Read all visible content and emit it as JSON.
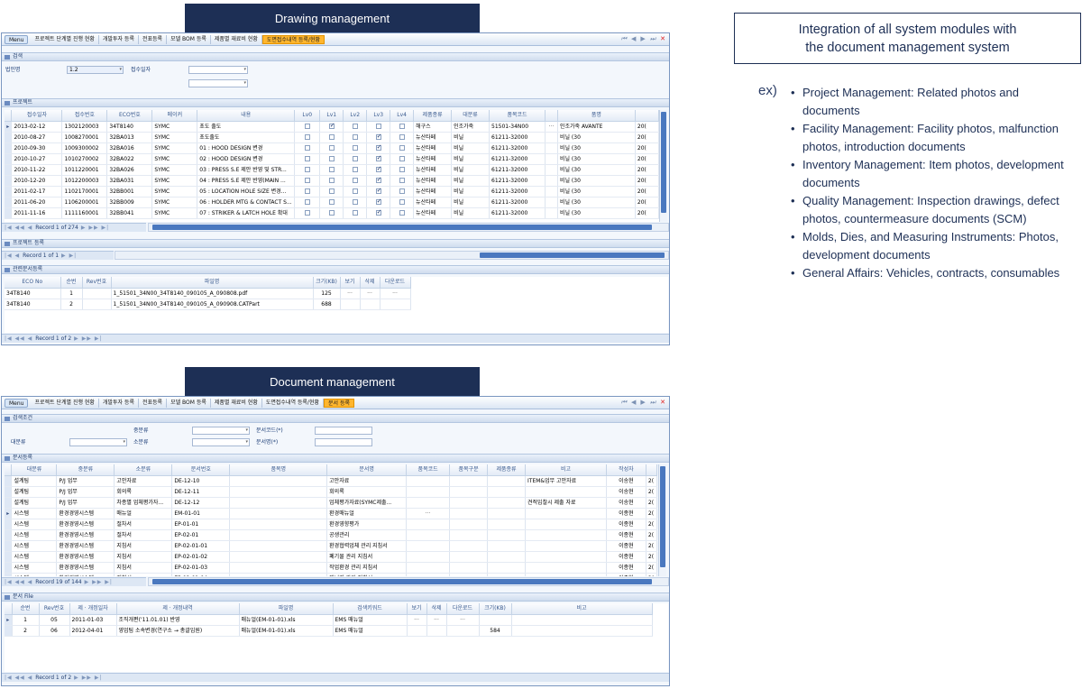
{
  "drawing": {
    "title": "Drawing management",
    "toolbar": {
      "menu": "Menu",
      "items": [
        "프로젝트 단계별 진행 현황",
        "개발투자 등록",
        "전표등록",
        "모델 BOM 등록",
        "제품별 재료비 현황"
      ],
      "active": "도면접수내역 등록/현황"
    },
    "search": {
      "section": "검색",
      "corp_label": "법인명",
      "corp_value": "1.2",
      "date_label": "접수일자"
    },
    "project": {
      "section": "프로젝트",
      "columns": [
        "접수일자",
        "접수번호",
        "ECO번호",
        "메이커",
        "내용",
        "Lv0",
        "Lv1",
        "Lv2",
        "Lv3",
        "Lv4",
        "제품종류",
        "대분류",
        "품목코드",
        "",
        "품명",
        ""
      ],
      "rows": [
        {
          "date": "2013-02-12",
          "no": "1302120003",
          "eco": "34T8140",
          "maker": "SYMC",
          "content": "초도 출도",
          "lv": [
            0,
            1,
            0,
            0,
            0
          ],
          "kind": "해구스",
          "cat": "인조가죽",
          "code": "51501-34N00",
          "name": "인조가죽 AVANTE",
          "extra": "20("
        },
        {
          "date": "2010-08-27",
          "no": "1008270001",
          "eco": "32BA013",
          "maker": "SYMC",
          "content": "초도출도",
          "lv": [
            0,
            0,
            0,
            1,
            0
          ],
          "kind": "뉴산타페",
          "cat": "비닐",
          "code": "61211-32000",
          "name": "비닐 (30",
          "extra": "20("
        },
        {
          "date": "2010-09-30",
          "no": "1009300002",
          "eco": "32BA016",
          "maker": "SYMC",
          "content": "01 : HOOD DESIGN 변경",
          "lv": [
            0,
            0,
            0,
            1,
            0
          ],
          "kind": "뉴산타페",
          "cat": "비닐",
          "code": "61211-32000",
          "name": "비닐 (30",
          "extra": "20("
        },
        {
          "date": "2010-10-27",
          "no": "1010270002",
          "eco": "32BA022",
          "maker": "SYMC",
          "content": "02 : HOOD DESIGN 변경",
          "lv": [
            0,
            0,
            0,
            1,
            0
          ],
          "kind": "뉴산타페",
          "cat": "비닐",
          "code": "61211-32000",
          "name": "비닐 (30",
          "extra": "20("
        },
        {
          "date": "2010-11-22",
          "no": "1011220001",
          "eco": "32BA026",
          "maker": "SYMC",
          "content": "03 : PRESS S.E 제안 반영 및 STR...",
          "lv": [
            0,
            0,
            0,
            1,
            0
          ],
          "kind": "뉴산타페",
          "cat": "비닐",
          "code": "61211-32000",
          "name": "비닐 (30",
          "extra": "20("
        },
        {
          "date": "2010-12-20",
          "no": "1012200003",
          "eco": "32BA031",
          "maker": "SYMC",
          "content": "04 : PRESS S.E 제안 반영(MAIN ...",
          "lv": [
            0,
            0,
            0,
            1,
            0
          ],
          "kind": "뉴산타페",
          "cat": "비닐",
          "code": "61211-32000",
          "name": "비닐 (30",
          "extra": "20("
        },
        {
          "date": "2011-02-17",
          "no": "1102170001",
          "eco": "32BB001",
          "maker": "SYMC",
          "content": "05 : LOCATION HOLE SIZE 변경...",
          "lv": [
            0,
            0,
            0,
            1,
            0
          ],
          "kind": "뉴산타페",
          "cat": "비닐",
          "code": "61211-32000",
          "name": "비닐 (30",
          "extra": "20("
        },
        {
          "date": "2011-06-20",
          "no": "1106200001",
          "eco": "32BB009",
          "maker": "SYMC",
          "content": "06 : HOLDER MTG & CONTACT S...",
          "lv": [
            0,
            0,
            0,
            1,
            0
          ],
          "kind": "뉴산타페",
          "cat": "비닐",
          "code": "61211-32000",
          "name": "비닐 (30",
          "extra": "20("
        },
        {
          "date": "2011-11-16",
          "no": "1111160001",
          "eco": "32BB041",
          "maker": "SYMC",
          "content": "07 : STRIKER & LATCH HOLE 확대",
          "lv": [
            0,
            0,
            0,
            1,
            0
          ],
          "kind": "뉴산타페",
          "cat": "비닐",
          "code": "61211-32000",
          "name": "비닐 (30",
          "extra": "20("
        }
      ],
      "record": "Record 1 of 274"
    },
    "project_reg": {
      "section": "프로젝트 등록",
      "record": "Record 1 of 1"
    },
    "docs": {
      "section": "관련문서등록",
      "columns": [
        "ECO No",
        "순번",
        "Rev번호",
        "파일명",
        "크기(KB)",
        "보기",
        "삭제",
        "다운로드"
      ],
      "rows": [
        {
          "eco": "34T8140",
          "seq": "1",
          "rev": "",
          "file": "1_51501_34N00_34T8140_090105_A_090808.pdf",
          "size": "125"
        },
        {
          "eco": "34T8140",
          "seq": "2",
          "rev": "",
          "file": "1_51501_34N00_34T8140_090105_A_090908.CATPart",
          "size": "688"
        }
      ],
      "record": "Record 1 of 2"
    }
  },
  "document": {
    "title": "Document management",
    "toolbar": {
      "menu": "Menu",
      "items": [
        "프로젝트 단계별 진행 현황",
        "개발투자 등록",
        "전표등록",
        "모델 BOM 등록",
        "제품별 재료비 현황",
        "도면접수내역 등록/현황"
      ],
      "active": "문서 등록"
    },
    "search": {
      "section": "검색조건",
      "mid_label": "중분류",
      "big_label": "대분류",
      "small_label": "소분류",
      "code_label": "문서코드(*)",
      "name_label": "문서명(*)"
    },
    "reg": {
      "section": "문서등록",
      "columns": [
        "대분류",
        "중분류",
        "소분류",
        "문서번호",
        "품목명",
        "문서명",
        "품목코드",
        "품목구분",
        "제품종류",
        "비고",
        "작성자",
        ""
      ],
      "rows": [
        {
          "big": "설계팀",
          "mid": "P/J 업무",
          "small": "고안자료",
          "no": "DE-12-10",
          "doc": "고안자료",
          "note": "ITEM&업무 고안자료",
          "author": "이송현",
          "x": "2("
        },
        {
          "big": "설계팀",
          "mid": "P/J 업무",
          "small": "회의록",
          "no": "DE-12-11",
          "doc": "회의록",
          "note": "",
          "author": "이송현",
          "x": "2("
        },
        {
          "big": "설계팀",
          "mid": "P/J 업무",
          "small": "차종별 업체평가자...",
          "no": "DE-12-12",
          "doc": "업체평가자료(SYMC제출...",
          "note": "견적입찰시 제출 자료",
          "author": "이송현",
          "x": "2("
        },
        {
          "big": "시스템",
          "mid": "환경경영시스템",
          "small": "매뉴얼",
          "no": "EM-01-01",
          "doc": "환경매뉴얼",
          "note": "",
          "author": "이종현",
          "x": "2("
        },
        {
          "big": "시스템",
          "mid": "환경경영시스템",
          "small": "절차서",
          "no": "EP-01-01",
          "doc": "환경영향평가",
          "note": "",
          "author": "이종현",
          "x": "2("
        },
        {
          "big": "시스템",
          "mid": "환경경영시스템",
          "small": "절차서",
          "no": "EP-02-01",
          "doc": "공생관리",
          "note": "",
          "author": "이종현",
          "x": "2("
        },
        {
          "big": "시스템",
          "mid": "환경경영시스템",
          "small": "지침서",
          "no": "EP-02-01-01",
          "doc": "환경협력업체 관리 지침서",
          "note": "",
          "author": "이종현",
          "x": "2("
        },
        {
          "big": "시스템",
          "mid": "환경경영시스템",
          "small": "지침서",
          "no": "EP-02-01-02",
          "doc": "폐기물 관리 지침서",
          "note": "",
          "author": "이종현",
          "x": "2("
        },
        {
          "big": "시스템",
          "mid": "환경경영시스템",
          "small": "지침서",
          "no": "EP-02-01-03",
          "doc": "작업환경 관리 지침서",
          "note": "",
          "author": "이종현",
          "x": "2("
        },
        {
          "big": "시스템",
          "mid": "환경경영시스템",
          "small": "지침서",
          "no": "EP-02-01-04",
          "doc": "에너지 관리 지침서",
          "note": "",
          "author": "이종현",
          "x": "2("
        }
      ],
      "record": "Record 19 of 144"
    },
    "file": {
      "section": "문서 File",
      "columns": [
        "순번",
        "Rev번호",
        "제 · 개정일자",
        "제 · 개정내역",
        "파일명",
        "검색키워드",
        "보기",
        "삭제",
        "다운로드",
        "크기(KB)",
        "비고"
      ],
      "rows": [
        {
          "seq": "1",
          "rev": "05",
          "date": "2011-01-03",
          "desc": "조직개편('11.01.01) 반영",
          "file": "매뉴얼(EM-01-01).xls",
          "kw": "EMS 매뉴얼",
          "size": ""
        },
        {
          "seq": "2",
          "rev": "06",
          "date": "2012-04-01",
          "desc": "영업팀 소속변경(연구소 → 총괄임원)",
          "file": "매뉴얼(EM-01-01).xls",
          "kw": "EMS 매뉴얼",
          "size": "584"
        }
      ],
      "record": "Record 1 of 2"
    }
  },
  "info": {
    "heading_line1": "Integration of all system modules with",
    "heading_line2": "the document management system",
    "ex": "ex)",
    "bullets": [
      "Project Management: Related photos and documents",
      "Facility Management: Facility photos, malfunction photos, introduction documents",
      "Inventory Management: Item photos, development documents",
      "Quality Management: Inspection drawings, defect photos, countermeasure documents (SCM)",
      "Molds, Dies, and Measuring Instruments: Photos, development documents",
      "General Affairs: Vehicles, contracts, consumables"
    ]
  },
  "colors": {
    "navy": "#1d2f55",
    "accent": "#ffb62e",
    "scroll": "#4a78bf"
  }
}
